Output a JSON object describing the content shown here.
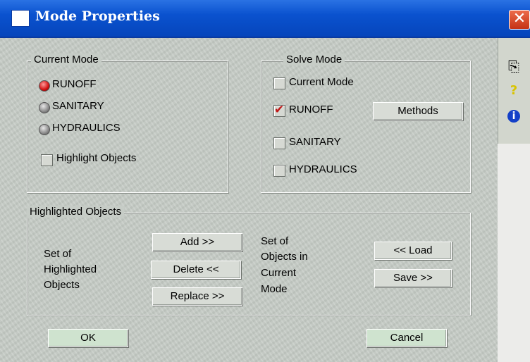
{
  "window": {
    "title": "Mode Properties",
    "close_glyph": "✕"
  },
  "side_toolbar": [
    {
      "icon": "copy-icon",
      "glyph": "⎘"
    },
    {
      "icon": "help-icon",
      "glyph": "?"
    },
    {
      "icon": "info-icon",
      "glyph": "i"
    }
  ],
  "current_mode": {
    "legend": "Current Mode",
    "options": [
      {
        "label": "RUNOFF",
        "selected": true
      },
      {
        "label": "SANITARY",
        "selected": false
      },
      {
        "label": "HYDRAULICS",
        "selected": false
      }
    ],
    "highlight_objects": {
      "label": "Highlight Objects",
      "checked": false
    }
  },
  "solve_mode": {
    "legend": "Solve Mode",
    "items": [
      {
        "label": "Current Mode",
        "checked": false
      },
      {
        "label": "RUNOFF",
        "checked": true
      },
      {
        "label": "SANITARY",
        "checked": false
      },
      {
        "label": "HYDRAULICS",
        "checked": false
      }
    ],
    "methods_button": "Methods"
  },
  "highlighted_objects": {
    "legend": "Highlighted Objects",
    "left_label": [
      "Set of",
      "Highlighted",
      "Objects"
    ],
    "add_button": "Add >>",
    "delete_button": "Delete <<",
    "replace_button": "Replace >>",
    "right_label": [
      "Set of",
      "Objects in",
      "Current",
      "Mode"
    ],
    "load_button": "<< Load",
    "save_button": "Save >>"
  },
  "footer": {
    "ok_button": "OK",
    "cancel_button": "Cancel"
  }
}
